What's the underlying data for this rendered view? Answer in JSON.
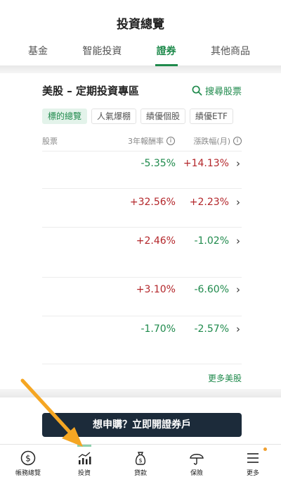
{
  "header": {
    "title": "投資總覽",
    "tabs": [
      {
        "label": "基金",
        "active": false
      },
      {
        "label": "智能投資",
        "active": false
      },
      {
        "label": "證券",
        "active": true
      },
      {
        "label": "其他商品",
        "active": false
      }
    ]
  },
  "section": {
    "title": "美股 – 定期投資專區",
    "search_label": "搜尋股票",
    "chips": [
      {
        "label": "標的總覽",
        "active": true
      },
      {
        "label": "人氣爆棚",
        "active": false
      },
      {
        "label": "績優個股",
        "active": false
      },
      {
        "label": "績優ETF",
        "active": false
      }
    ],
    "columns": {
      "stock": "股票",
      "return_3y": "3年報酬率",
      "change_month": "漲跌幅(月)"
    },
    "rows": [
      {
        "return_3y": "-5.35%",
        "change_month": "+14.13%"
      },
      {
        "return_3y": "+32.56%",
        "change_month": "+2.23%"
      },
      {
        "return_3y": "+2.46%",
        "change_month": "-1.02%"
      },
      {
        "return_3y": "+3.10%",
        "change_month": "-6.60%"
      },
      {
        "return_3y": "-1.70%",
        "change_month": "-2.57%"
      }
    ],
    "more_label": "更多美股"
  },
  "cta": {
    "label": "想申購？立即開證券戶"
  },
  "bottom_nav": [
    {
      "label": "帳務總覽",
      "icon": "dollar-circle-icon",
      "active": false
    },
    {
      "label": "投資",
      "icon": "bar-chart-icon",
      "active": true
    },
    {
      "label": "貸款",
      "icon": "money-bag-icon",
      "active": false
    },
    {
      "label": "保險",
      "icon": "umbrella-icon",
      "active": false
    },
    {
      "label": "更多",
      "icon": "menu-icon",
      "active": false
    }
  ],
  "colors": {
    "accent": "#1f8a4c",
    "positive": "#b3262a",
    "negative": "#1f8a4c",
    "cta_bg": "#1c2b3a",
    "annotation_arrow": "#f5a623"
  }
}
